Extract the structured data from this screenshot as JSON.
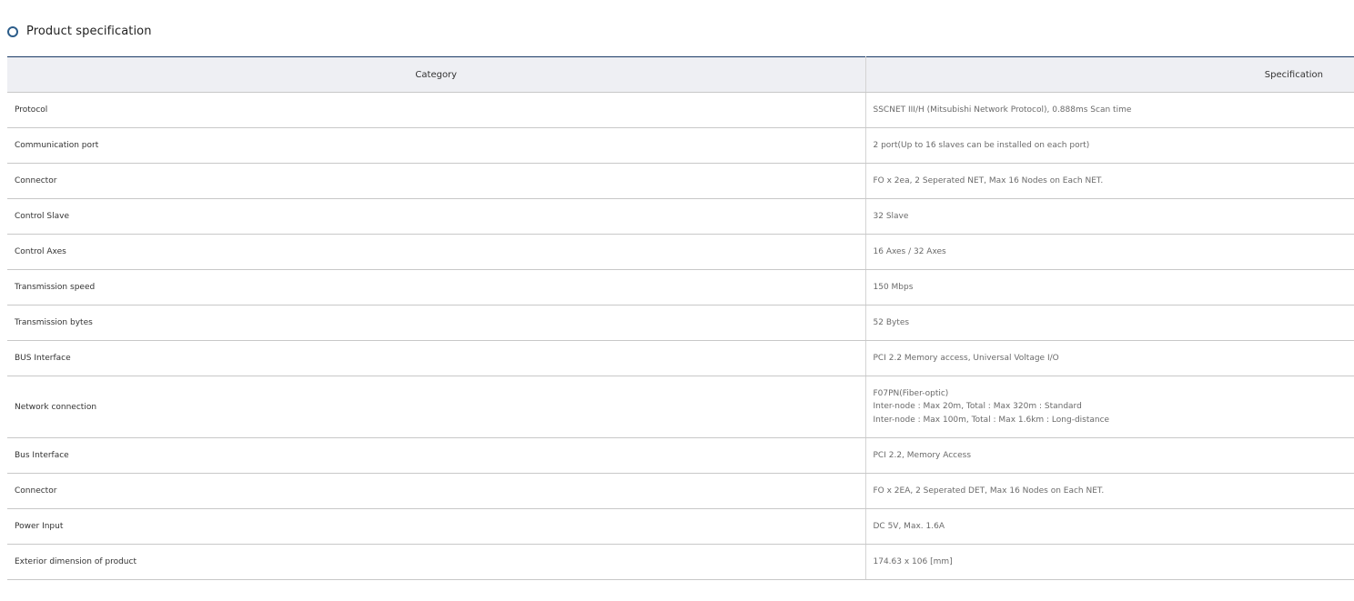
{
  "section": {
    "title": "Product specification",
    "icon": "hexagon-bullet-icon",
    "accent_color": "#2c5d8a"
  },
  "table": {
    "headers": {
      "category": "Category",
      "specification": "Specification"
    },
    "rows": [
      {
        "category": "Protocol",
        "spec": [
          "SSCNET III/H (Mitsubishi Network Protocol), 0.888ms Scan time"
        ]
      },
      {
        "category": "Communication port",
        "spec": [
          "2 port(Up to 16 slaves can be installed on each port)"
        ]
      },
      {
        "category": "Connector",
        "spec": [
          "FO x 2ea, 2 Seperated NET, Max 16 Nodes on Each NET."
        ]
      },
      {
        "category": "Control Slave",
        "spec": [
          "32 Slave"
        ]
      },
      {
        "category": "Control Axes",
        "spec": [
          "16 Axes / 32 Axes"
        ]
      },
      {
        "category": "Transmission speed",
        "spec": [
          "150 Mbps"
        ]
      },
      {
        "category": "Transmission bytes",
        "spec": [
          "52 Bytes"
        ]
      },
      {
        "category": "BUS Interface",
        "spec": [
          "PCI 2.2 Memory access, Universal Voltage I/O"
        ]
      },
      {
        "category": "Network connection",
        "spec": [
          "F07PN(Fiber-optic)",
          "Inter-node : Max 20m, Total : Max 320m : Standard",
          "Inter-node : Max 100m, Total : Max 1.6km : Long-distance"
        ]
      },
      {
        "category": "Bus Interface",
        "spec": [
          "PCI 2.2, Memory Access"
        ]
      },
      {
        "category": "Connector",
        "spec": [
          "FO x 2EA, 2 Seperated DET, Max 16 Nodes on Each NET."
        ]
      },
      {
        "category": "Power Input",
        "spec": [
          "DC 5V, Max. 1.6A"
        ]
      },
      {
        "category": "Exterior dimension of product",
        "spec": [
          "174.63 x 106 [mm]"
        ]
      }
    ]
  }
}
